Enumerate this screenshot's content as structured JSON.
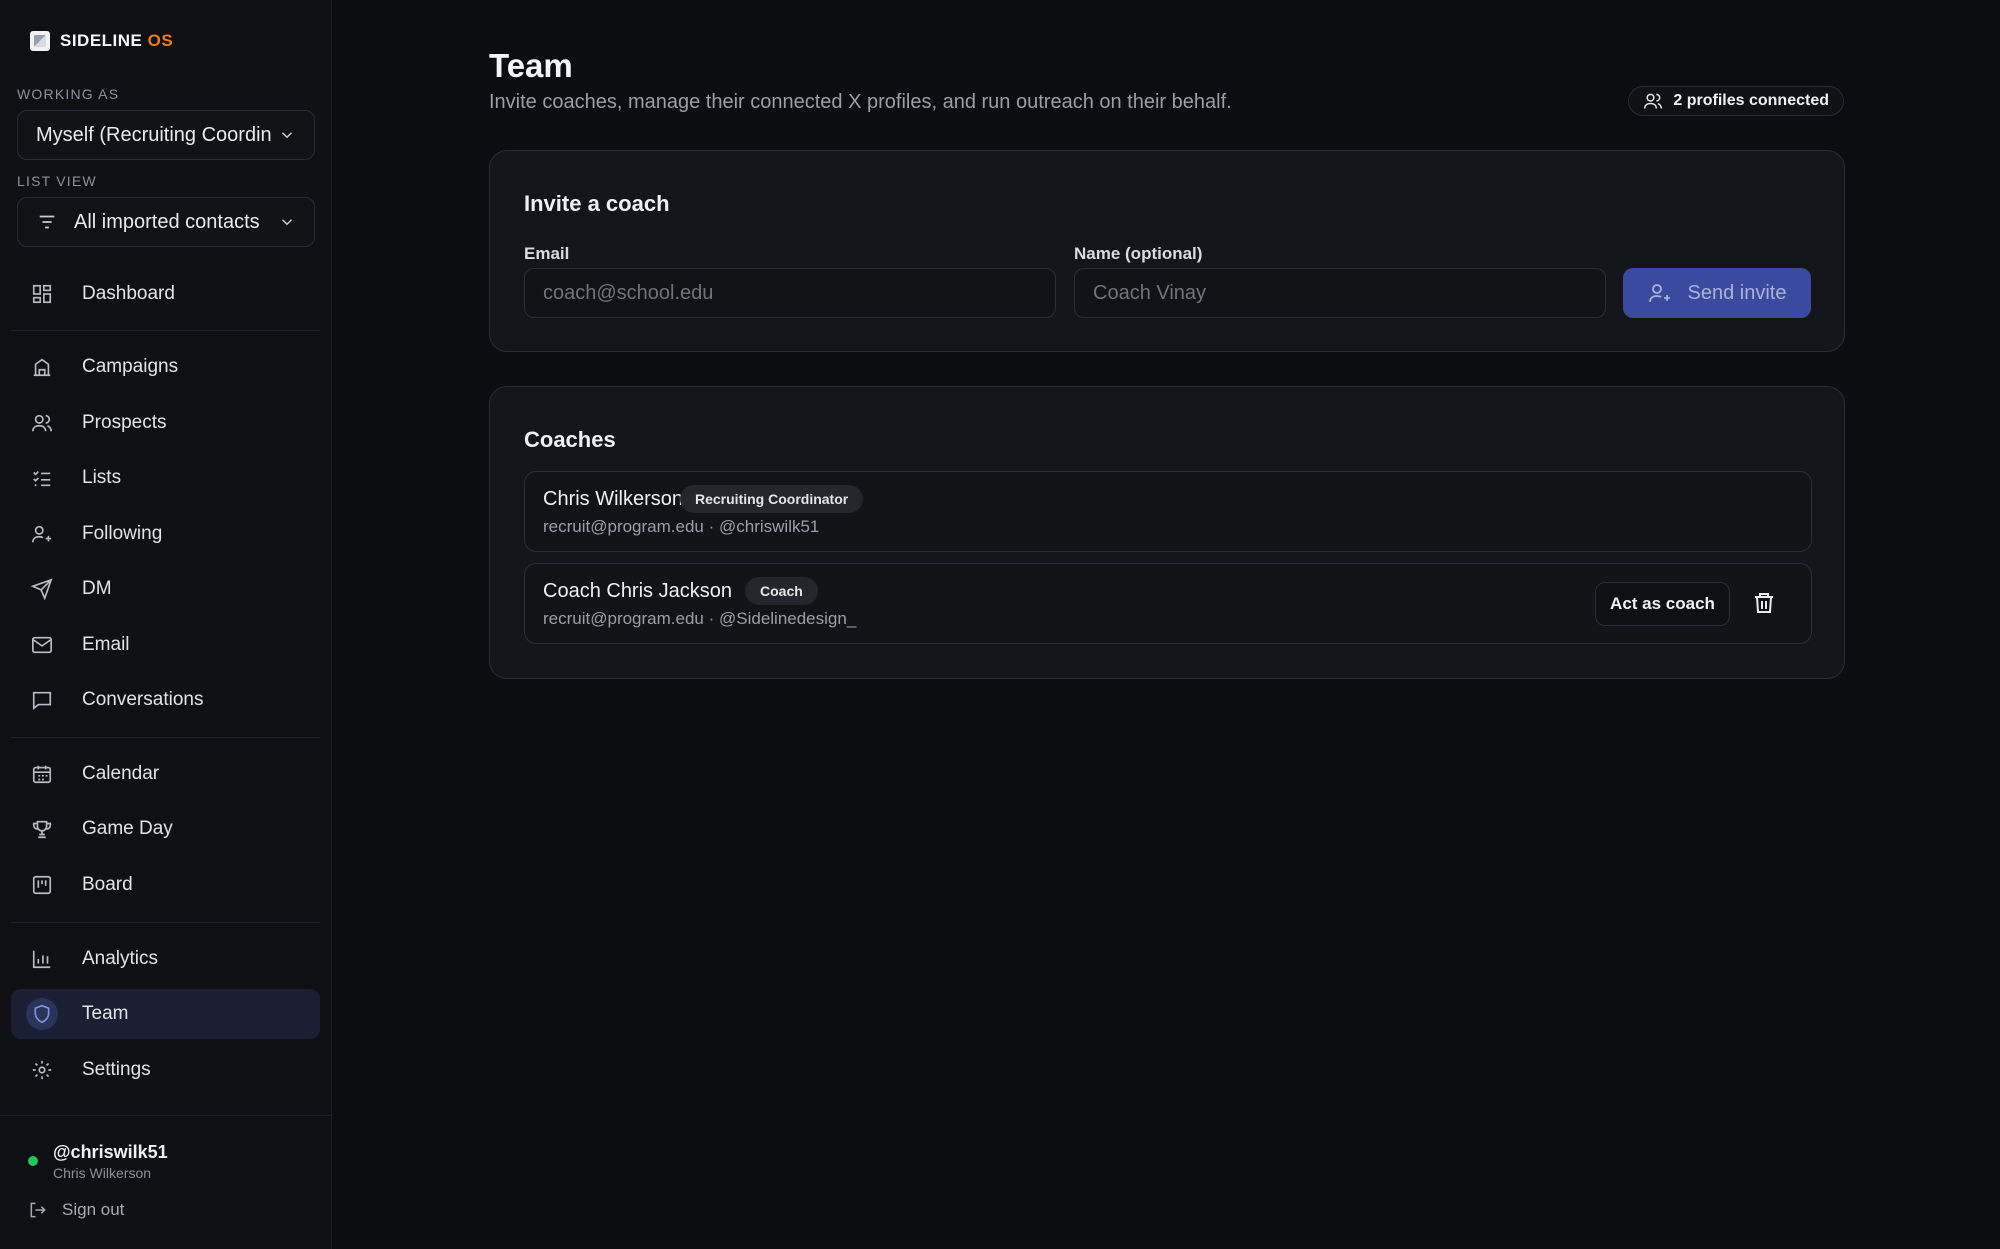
{
  "app": {
    "logo_main": "SIDELINE",
    "logo_accent": "OS"
  },
  "sidebar": {
    "working_as_label": "WORKING AS",
    "working_as_value": "Myself (Recruiting Coordinator)",
    "list_view_label": "LIST VIEW",
    "list_view_value": "All imported contacts",
    "items": [
      {
        "label": "Dashboard",
        "icon": "dashboard-icon"
      },
      {
        "label": "Campaigns",
        "icon": "campaigns-icon"
      },
      {
        "label": "Prospects",
        "icon": "users-icon"
      },
      {
        "label": "Lists",
        "icon": "list-check-icon"
      },
      {
        "label": "Following",
        "icon": "user-plus-icon"
      },
      {
        "label": "DM",
        "icon": "send-icon"
      },
      {
        "label": "Email",
        "icon": "mail-icon"
      },
      {
        "label": "Conversations",
        "icon": "message-icon"
      },
      {
        "label": "Calendar",
        "icon": "calendar-icon"
      },
      {
        "label": "Game Day",
        "icon": "trophy-icon"
      },
      {
        "label": "Board",
        "icon": "kanban-icon"
      },
      {
        "label": "Analytics",
        "icon": "bar-chart-icon"
      },
      {
        "label": "Team",
        "icon": "shield-icon",
        "active": true
      },
      {
        "label": "Settings",
        "icon": "gear-icon"
      }
    ],
    "user": {
      "handle": "@chriswilk51",
      "name": "Chris Wilkerson",
      "status_color": "#22c55e"
    },
    "sign_out_label": "Sign out"
  },
  "main": {
    "title": "Team",
    "subtitle": "Invite coaches, manage their connected X profiles, and run outreach on their behalf.",
    "profiles_connected": "2 profiles connected",
    "invite": {
      "title": "Invite a coach",
      "email_label": "Email",
      "email_placeholder": "coach@school.edu",
      "name_label": "Name (optional)",
      "name_placeholder": "Coach Vinay",
      "send_label": "Send invite"
    },
    "coaches": {
      "title": "Coaches",
      "rows": [
        {
          "name": "Chris Wilkerson",
          "role": "Recruiting Coordinator",
          "meta": "recruit@program.edu · @chriswilk51"
        },
        {
          "name": "Coach Chris Jackson",
          "role": "Coach",
          "meta": "recruit@program.edu · @Sidelinedesign_",
          "action_label": "Act as coach"
        }
      ]
    }
  },
  "colors": {
    "accent": "#3b4a9e",
    "logo_accent": "#f07a1a",
    "background": "#0c0d10"
  }
}
